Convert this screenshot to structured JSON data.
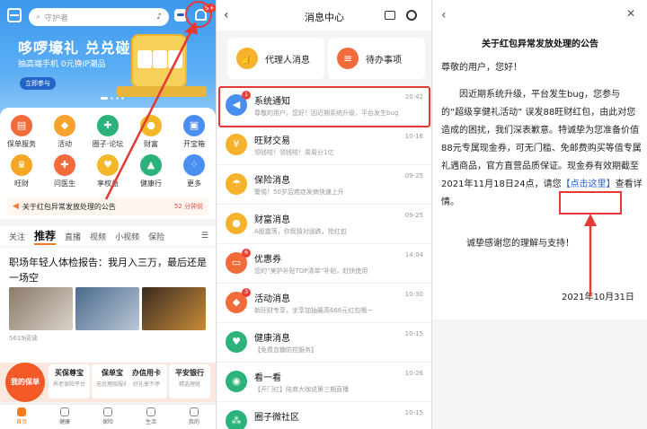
{
  "panel1": {
    "search_placeholder": "守护者",
    "bell_badge": "9+",
    "promo": {
      "title": "哆啰壕礼 兑兑碰",
      "subtitle": "抽高端手机 0元换IP潮品",
      "button": "立即参与"
    },
    "grid": [
      {
        "label": "保单服务",
        "icon": "policy-icon",
        "color": "#f26b3a"
      },
      {
        "label": "活动",
        "icon": "gift-icon",
        "color": "#f6a22b"
      },
      {
        "label": "圈子·论坛",
        "icon": "forum-icon",
        "color": "#2bb37b"
      },
      {
        "label": "财富",
        "icon": "coin-icon",
        "color": "#f4b728"
      },
      {
        "label": "开宝箱",
        "icon": "treasure-icon",
        "color": "#4a8ff0"
      },
      {
        "label": "旺财",
        "icon": "wangcai-icon",
        "color": "#f5a623"
      },
      {
        "label": "问医生",
        "icon": "doctor-icon",
        "color": "#f26b3a"
      },
      {
        "label": "享权益",
        "icon": "rights-icon",
        "color": "#f4b728"
      },
      {
        "label": "健康行",
        "icon": "shoe-icon",
        "color": "#2bb37b"
      },
      {
        "label": "更多",
        "icon": "more-icon",
        "color": "#4a8ff0"
      }
    ],
    "notice": {
      "text": "关于红包异常发放处理的公告",
      "time": "52 分钟前"
    },
    "tabs": [
      "关注",
      "推荐",
      "直播",
      "视频",
      "小视频",
      "保险"
    ],
    "active_tab": "推荐",
    "article": {
      "title": "职场年轻人体检报告：我月入三万，最后还是一场空",
      "reads": "5619阅读"
    },
    "my_policy": "我的保单",
    "cards": [
      {
        "title": "买保尊宝",
        "sub": "养老保险平台"
      },
      {
        "title": "保单宝",
        "sub": "无忧理赔服务"
      },
      {
        "title": "办信用卡",
        "sub": "好礼享不停"
      },
      {
        "title": "平安银行",
        "sub": "精选理财"
      }
    ],
    "tabbar": [
      "首页",
      "健康",
      "保险",
      "生活",
      "我的"
    ]
  },
  "panel2": {
    "title": "消息中心",
    "quick": [
      {
        "label": "代理人消息",
        "color": "#f6b22b"
      },
      {
        "label": "待办事项",
        "color": "#f26b3a"
      }
    ],
    "messages": [
      {
        "name": "系统通知",
        "desc": "尊敬的用户，您好！因近期系统升级，平台发生bug",
        "date": "20:42",
        "badge": "1",
        "color": "#4a8ff0",
        "icon": "megaphone-icon"
      },
      {
        "name": "旺财交易",
        "desc": "领钱啦！领钱啦！周周分1亿",
        "date": "10-16",
        "badge": "",
        "color": "#f6b22b",
        "icon": "wangcai-icon"
      },
      {
        "name": "保险消息",
        "desc": "警惕！50岁后癌症发病快速上升",
        "date": "09-25",
        "badge": "",
        "color": "#f6b22b",
        "icon": "umbrella-icon"
      },
      {
        "name": "财富消息",
        "desc": "A股震荡，你我猜对涨跌，抢红包",
        "date": "09-25",
        "badge": "",
        "color": "#f6b22b",
        "icon": "piggy-icon"
      },
      {
        "name": "优惠券",
        "desc": "您的“美护补贴TOP清单”补贴，赶快使用",
        "date": "14:04",
        "badge": "6",
        "color": "#f26b3a",
        "icon": "coupon-icon"
      },
      {
        "name": "活动消息",
        "desc": "新旺财专享，坐享加抽最高666元红包哦~",
        "date": "10-30",
        "badge": "3",
        "color": "#f26b3a",
        "icon": "gift-icon"
      },
      {
        "name": "健康消息",
        "desc": "【免费血糖防控服务】",
        "date": "10-15",
        "badge": "",
        "color": "#2bb37b",
        "icon": "heart-icon"
      },
      {
        "name": "看一看",
        "desc": "【开门红】陆商大咖说第三期直播",
        "date": "10-26",
        "badge": "",
        "color": "#2bb37b",
        "icon": "eye-icon"
      },
      {
        "name": "圈子微社区",
        "desc": "",
        "date": "10-15",
        "badge": "",
        "color": "#2bb37b",
        "icon": "community-icon"
      }
    ]
  },
  "panel3": {
    "title": "关于红包异常发放处理的公告",
    "greeting": "尊敬的用户，您好！",
    "body_before": "因近期系统升级，平台发生bug，您参与的“超级享健礼活动” 误发88旺财红包，由此对您造成的困扰，我们深表歉意。特诚挚为您准备价值88元专属现金券，可无门槛、免邮费购买等值专属礼遇商品，官方直营品质保证。现金券有效期截至2021年11月18日24点，请您",
    "link": "【点击这里】",
    "body_after": "查看详情。",
    "thanks": "诚挚感谢您的理解与支持！",
    "date": "2021年10月31日"
  }
}
